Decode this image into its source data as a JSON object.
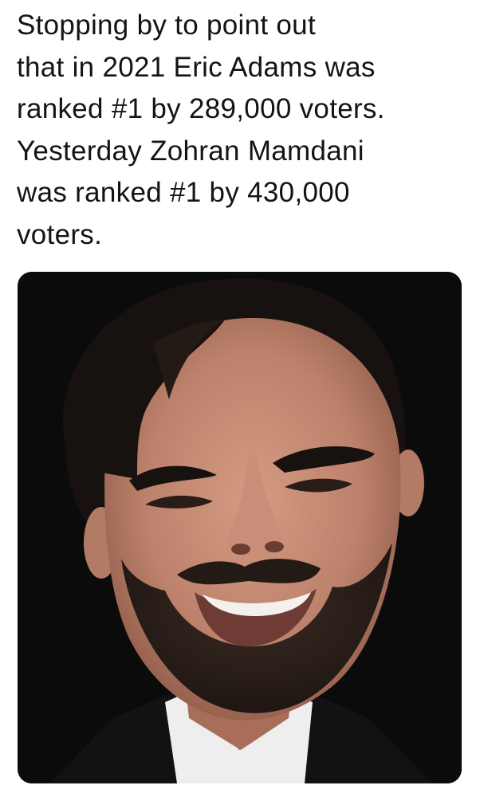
{
  "post": {
    "text": "Stopping by to point out\nthat in 2021 Eric Adams was\nranked #1 by 289,000 voters.\nYesterday Zohran Mamdani\nwas ranked #1 by 430,000\nvoters."
  },
  "media": {
    "type": "photo",
    "background_color": "#0c0b0c",
    "skin_color": "#c08a74",
    "hair_color": "#17120f",
    "shirt_color": "#efefef",
    "jacket_color": "#121113"
  }
}
